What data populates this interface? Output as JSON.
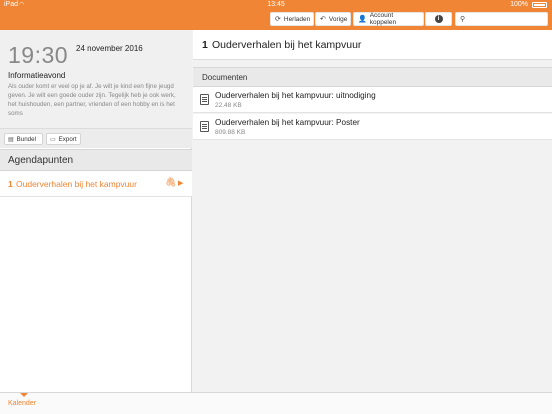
{
  "status_bar": {
    "carrier": "iPad",
    "time": "13:45",
    "battery": "100%"
  },
  "toolbar": {
    "reload_label": "Herladen",
    "previous_label": "Vorige",
    "link_account_label": "Account koppelen",
    "search_placeholder": ""
  },
  "event": {
    "time": "19:30",
    "date": "24 november 2016",
    "title": "Informatieavond",
    "description": "Als ouder komt er veel op je af. Je wilt je kind een fijne jeugd geven. Je wilt een goede ouder zijn. Tegelijk heb je ook werk, het huishouden, een partner, vrienden of een hobby en is het soms"
  },
  "left_buttons": {
    "bundle_label": "Bundel",
    "export_label": "Export"
  },
  "agenda": {
    "header": "Agendapunten",
    "items": [
      {
        "number": "1",
        "title": "Ouderverhalen bij het kampvuur"
      }
    ]
  },
  "detail": {
    "number": "1",
    "title": "Ouderverhalen bij het kampvuur",
    "documents_header": "Documenten",
    "documents": [
      {
        "name": "Ouderverhalen bij het kampvuur: uitnodiging",
        "size": "22.48 KB"
      },
      {
        "name": "Ouderverhalen bij het kampvuur: Poster",
        "size": "809.88 KB"
      }
    ]
  },
  "tabbar": {
    "calendar_label": "Kalender"
  },
  "colors": {
    "accent": "#f08535"
  },
  "icons": [
    "wifi-icon",
    "battery-icon",
    "reload-icon",
    "back-icon",
    "account-icon",
    "info-icon",
    "search-icon",
    "bundle-icon",
    "export-icon",
    "paperclip-icon",
    "play-icon",
    "document-icon"
  ]
}
